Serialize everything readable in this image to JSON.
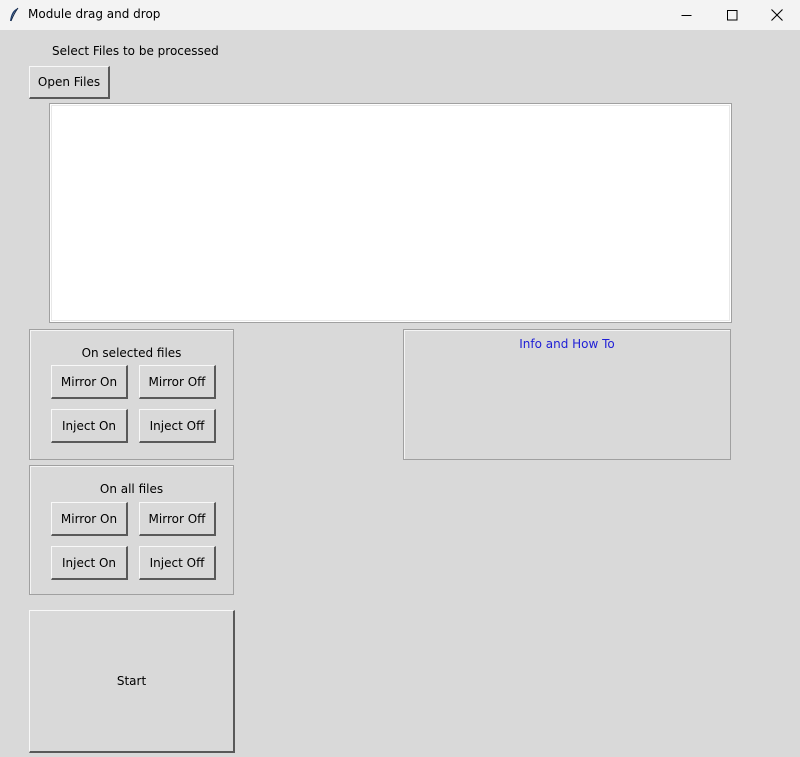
{
  "window": {
    "title": "Module drag and drop",
    "icon": "feather-icon",
    "controls": [
      "minimize-icon",
      "maximize-icon",
      "close-icon"
    ]
  },
  "main": {
    "select_label": "Select Files to be processed",
    "open_files_label": "Open Files"
  },
  "selected_files": {
    "title": "On selected files",
    "mirror_on": "Mirror On",
    "mirror_off": "Mirror Off",
    "inject_on": "Inject On",
    "inject_off": "Inject Off"
  },
  "all_files": {
    "title": "On all files",
    "mirror_on": "Mirror On",
    "mirror_off": "Mirror Off",
    "inject_on": "Inject On",
    "inject_off": "Inject Off"
  },
  "info": {
    "title": "Info and How To",
    "title_color": "#1f1fd6"
  },
  "start_label": "Start"
}
